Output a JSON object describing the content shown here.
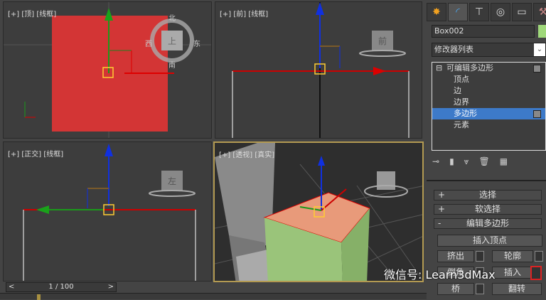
{
  "viewports": {
    "top": {
      "label": "[+] [顶] [线框]",
      "cube_label": "上",
      "compass": {
        "n": "北",
        "s": "南",
        "e": "东",
        "w": "西"
      }
    },
    "front": {
      "label": "[+] [前] [线框]",
      "cube_label": "前"
    },
    "left": {
      "label": "[+] [正交] [线框]",
      "cube_label": "左"
    },
    "perspective": {
      "label": "[+] [透视] [真实]"
    }
  },
  "command_panel": {
    "object_name": "Box002",
    "object_color": "#9fd87a",
    "modifier_list": "修改器列表",
    "stack": [
      {
        "label": "可编辑多边形",
        "root": true
      },
      {
        "label": "顶点"
      },
      {
        "label": "边"
      },
      {
        "label": "边界"
      },
      {
        "label": "多边形",
        "selected": true
      },
      {
        "label": "元素"
      }
    ],
    "rollouts": [
      {
        "sign": "+",
        "label": "选择"
      },
      {
        "sign": "+",
        "label": "软选择"
      },
      {
        "sign": "-",
        "label": "编辑多边形"
      }
    ],
    "buttons": {
      "insert_vertex": "插入顶点",
      "extrude": "挤出",
      "outline": "轮廓",
      "bevel": "倒角",
      "inset": "插入",
      "bridge": "桥",
      "flip": "翻转"
    }
  },
  "timeline": {
    "frame": "1 / 100",
    "prev": "<",
    "next": ">"
  },
  "watermark": "微信号: Learn3dMax"
}
